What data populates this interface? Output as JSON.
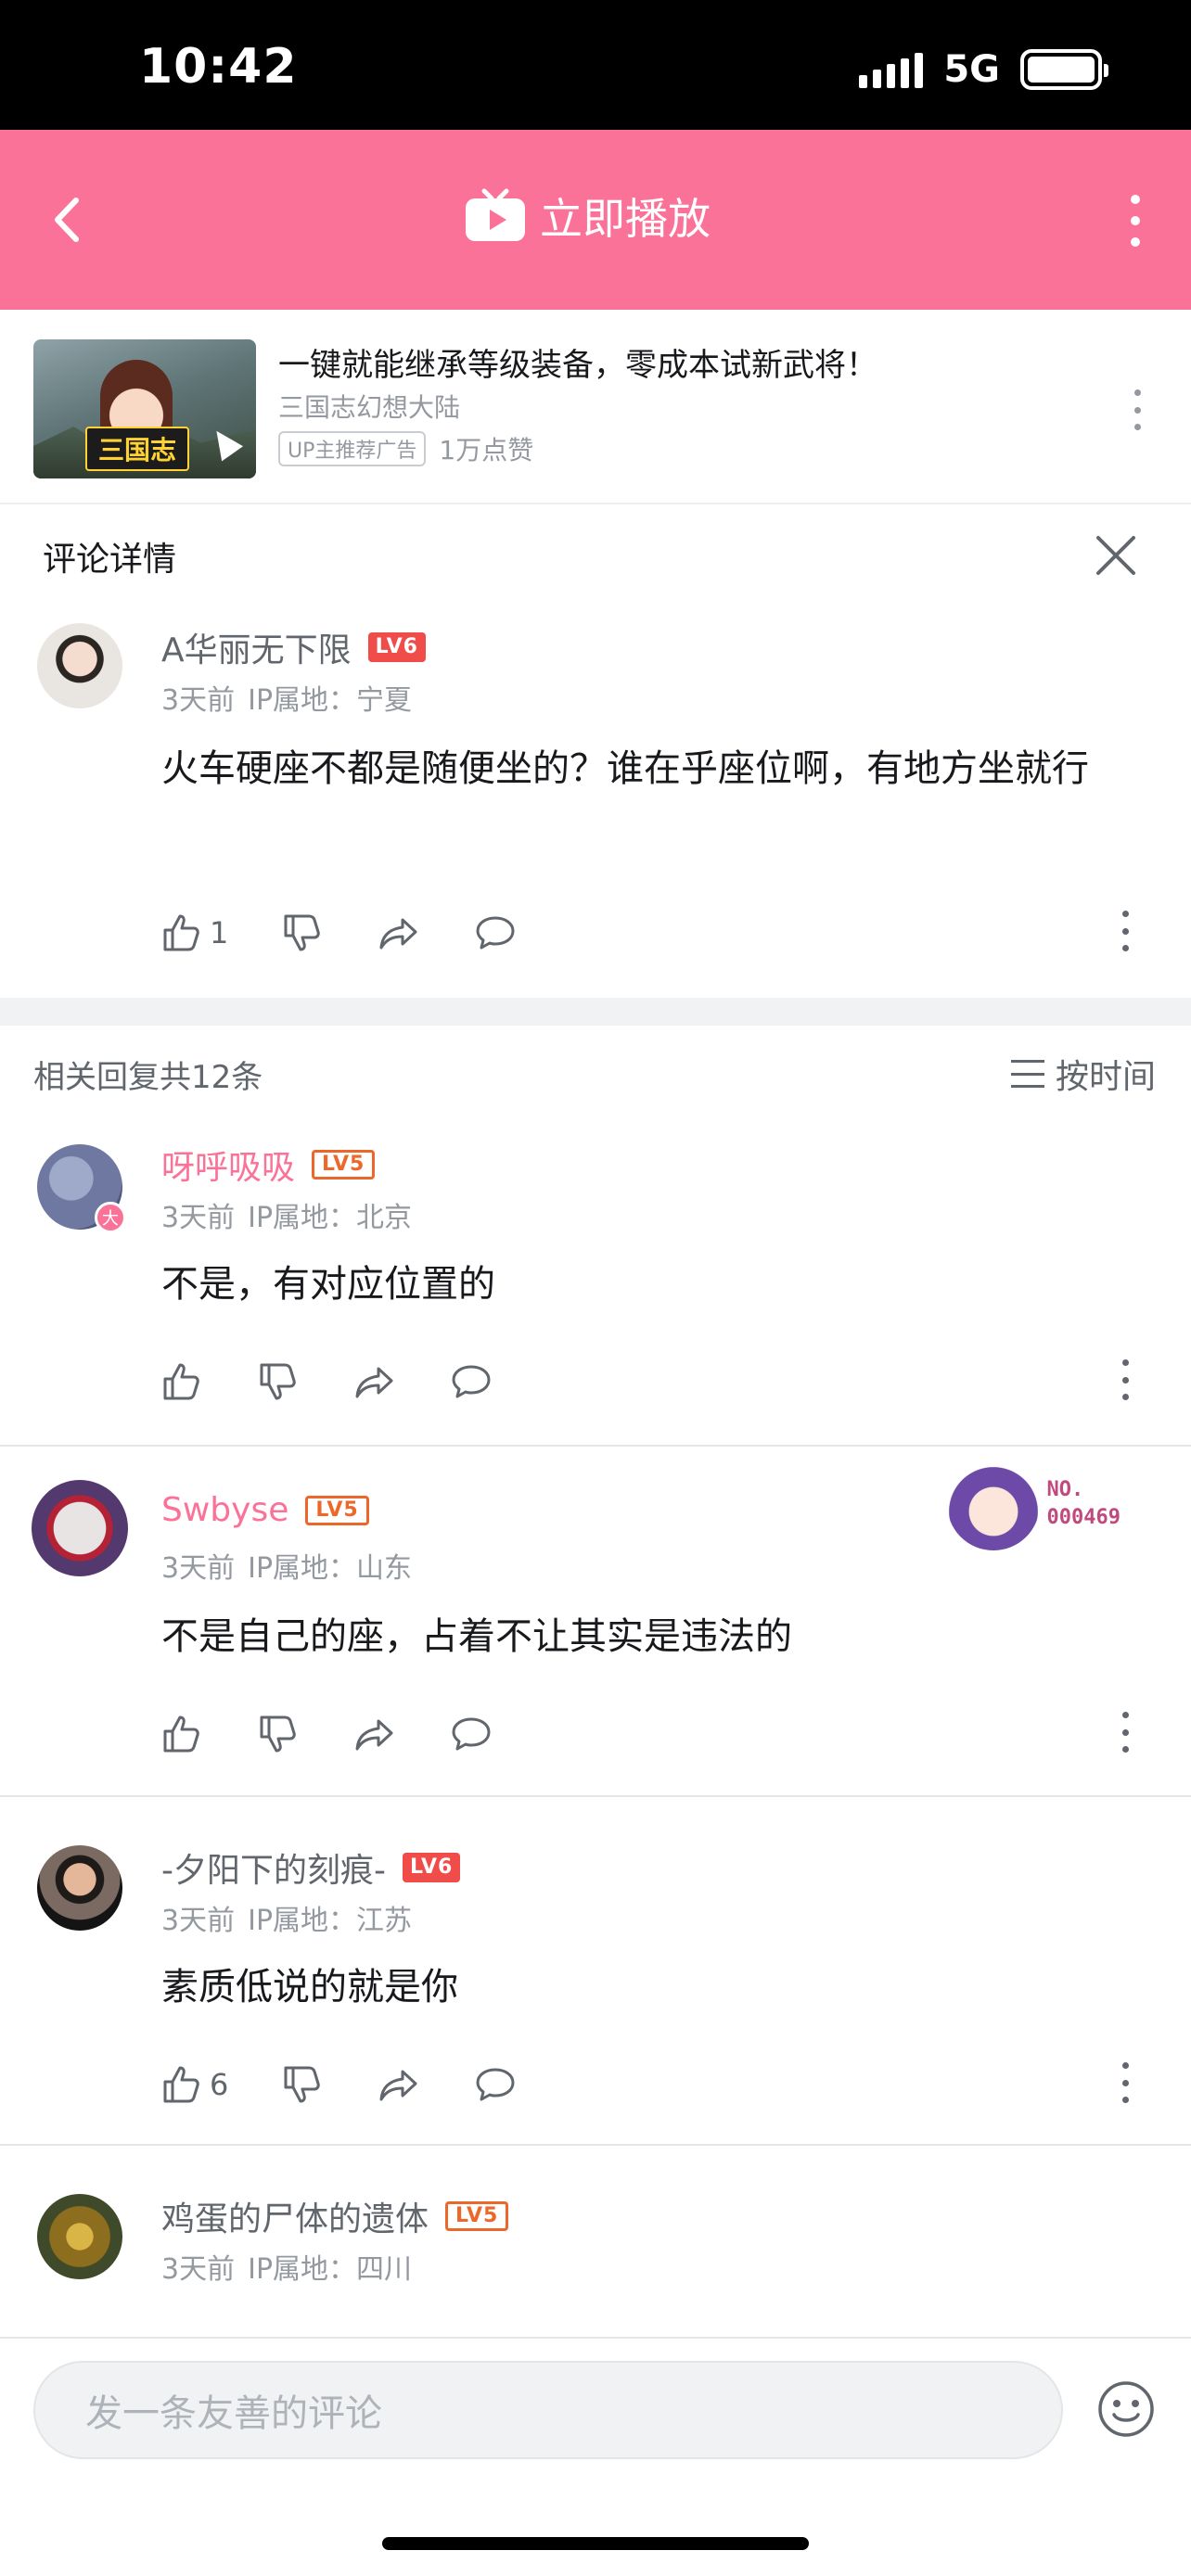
{
  "status_bar": {
    "time": "10:42",
    "network": "5G"
  },
  "header": {
    "play_label": "立即播放"
  },
  "ad": {
    "thumb_tag": "三国志",
    "title": "一键就能继承等级装备，零成本试新武将！",
    "subtitle": "三国志幻想大陆",
    "badge": "UP主推荐广告",
    "likes": "1万点赞"
  },
  "detail": {
    "title": "评论详情"
  },
  "root_comment": {
    "username": "A华丽无下限",
    "level": "LV6",
    "time": "3天前",
    "ip": "IP属地：宁夏",
    "content": "火车硬座不都是随便坐的？谁在乎座位啊，有地方坐就行",
    "like_count": "1"
  },
  "replies": {
    "count_label": "相关回复共12条",
    "sort_label": "按时间",
    "items": [
      {
        "username": "呀呼吸吸",
        "level": "LV5",
        "time": "3天前",
        "ip": "IP属地：北京",
        "content": "不是，有对应位置的",
        "like_count": "",
        "avatar_badge": "大"
      },
      {
        "username": "Swbyse",
        "level": "LV5",
        "time": "3天前",
        "ip": "IP属地：山东",
        "content": "不是自己的座，占着不让其实是违法的",
        "like_count": "",
        "fan_badge": "NO.\n000469"
      },
      {
        "username": "-夕阳下的刻痕-",
        "level": "LV6",
        "time": "3天前",
        "ip": "IP属地：江苏",
        "content": "素质低说的就是你",
        "like_count": "6"
      },
      {
        "username": "鸡蛋的尸体的遗体",
        "level": "LV5",
        "time": "3天前",
        "ip": "IP属地：四川",
        "content": "",
        "like_count": ""
      }
    ]
  },
  "input": {
    "placeholder": "发一条友善的评论"
  },
  "colors": {
    "brand_pink": "#fb7299",
    "level_orange": "#ee672a",
    "text_gray": "#9499a0"
  },
  "icons": [
    "back-icon",
    "tv-play-icon",
    "more-icon",
    "close-icon",
    "like-icon",
    "dislike-icon",
    "share-icon",
    "reply-icon",
    "sort-icon",
    "emoji-icon"
  ]
}
